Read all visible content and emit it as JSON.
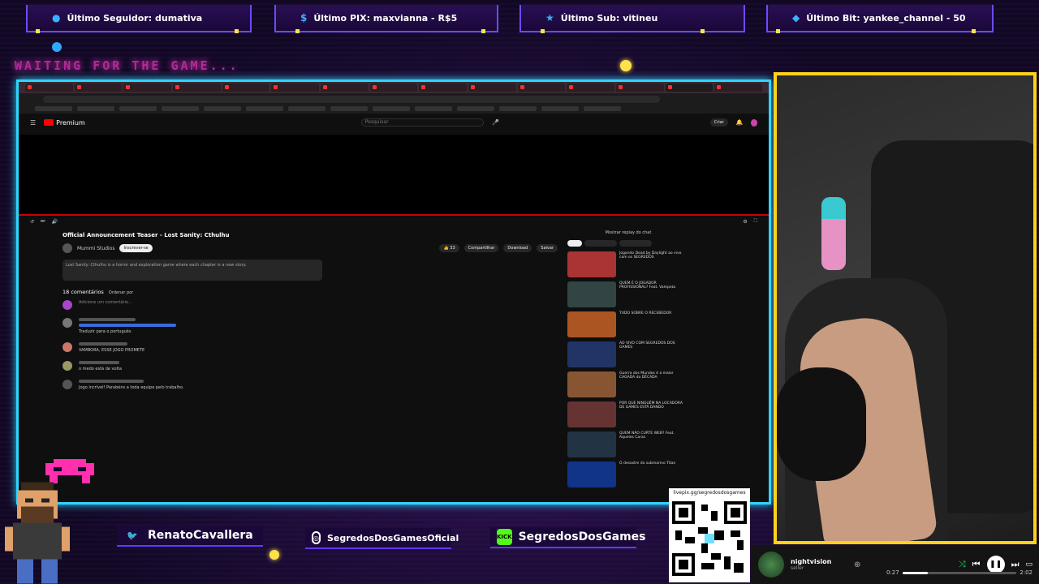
{
  "alerts": {
    "follower": {
      "label": "Último Seguidor: dumativa",
      "icon": "user-icon"
    },
    "pix": {
      "label": "Último PIX: maxvianna - R$5",
      "icon": "dollar-icon"
    },
    "sub": {
      "label": "Último Sub: vitineu",
      "icon": "star-icon"
    },
    "bit": {
      "label": "Último Bit: yankee_channel - 50",
      "icon": "diamond-icon"
    }
  },
  "waiting_text": "WAITING FOR THE GAME...",
  "browser": {
    "yt_logo": "Premium",
    "search_placeholder": "Pesquisar",
    "create_label": "Criar",
    "video_title": "Official Announcement Teaser - Lost Sanity: Cthulhu",
    "channel_name": "Mummi Studios",
    "subscribe_label": "Inscrever-se",
    "share_label": "Compartilhar",
    "download_label": "Download",
    "save_label": "Salvar",
    "description": "Lost Sanity: Cthulhu is a horror and exploration game where each chapter is a new story.",
    "comments_count": "18 comentários",
    "sort_label": "Ordenar por",
    "comment_placeholder": "Adicione um comentário...",
    "live_chat_label": "Mostrar replay do chat",
    "comments": [
      {
        "text": "Traduzir para o português"
      },
      {
        "text": "VAMBORA, ESSE JOGO PROMETE"
      },
      {
        "text": "o medo está de volta"
      },
      {
        "text": "Jogo incrível! Parabéns a toda equipe pelo trabalho."
      }
    ],
    "recommended": [
      {
        "title": "Jogando Dead by Daylight ao vivo com os SEGREDOS",
        "color": "#a33"
      },
      {
        "title": "QUEM É O JOGADOR PROFISSIONAL? Feat. Vampeta",
        "color": "#344"
      },
      {
        "title": "TUDO SOBRE O RECEBEDOR",
        "color": "#a52"
      },
      {
        "title": "AO VIVO COM SEGREDOS DOS GAMES",
        "color": "#236"
      },
      {
        "title": "Guerra dos Mundos é a maior CAGADA da DÉCADA",
        "color": "#853"
      },
      {
        "title": "POR QUE NINGUÉM NA LOCADORA DE GAMES ESTÁ DANDO",
        "color": "#633"
      },
      {
        "title": "QUEM NÃO CURTE WEB? Feat. Aqueles Caras",
        "color": "#234"
      },
      {
        "title": "O desastre do submarino Titan",
        "color": "#138"
      }
    ]
  },
  "socials": {
    "twitter": {
      "label": "RenatoCavallera",
      "icon": "twitter-icon"
    },
    "instagram": {
      "label": "SegredosDosGamesOficial",
      "icon": "instagram-icon"
    },
    "kick": {
      "label": "SegredosDosGames",
      "icon_text": "KICK"
    }
  },
  "qr": {
    "url": "livepix.gg/segredosdosgames"
  },
  "music": {
    "title": "nightvision",
    "artist": "seller",
    "elapsed": "0:27",
    "duration": "2:02",
    "progress": 0.22
  },
  "colors": {
    "accent_cyan": "#2fd4ff",
    "accent_yellow": "#ffd21a",
    "accent_purple": "#6a4cff",
    "kick_green": "#53fc18"
  }
}
